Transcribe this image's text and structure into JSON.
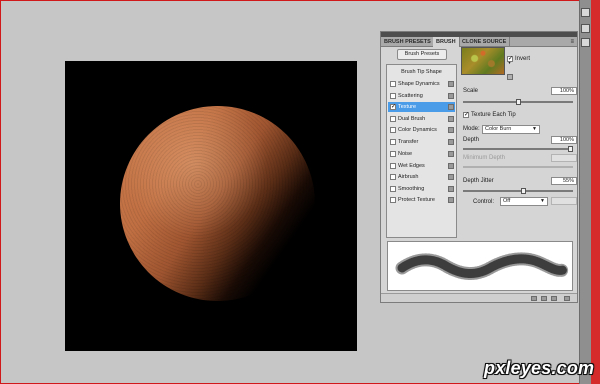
{
  "tabs": [
    "BRUSH PRESETS",
    "BRUSH",
    "CLONE SOURCE"
  ],
  "panel_menu_icon": "panel-menu-icon",
  "brush_presets_button": "Brush Presets",
  "brush_tip_shape": "Brush Tip Shape",
  "options": [
    {
      "label": "Shape Dynamics",
      "checked": false
    },
    {
      "label": "Scattering",
      "checked": false
    },
    {
      "label": "Texture",
      "checked": true,
      "selected": true
    },
    {
      "label": "Dual Brush",
      "checked": false
    },
    {
      "label": "Color Dynamics",
      "checked": false
    },
    {
      "label": "Transfer",
      "checked": false
    },
    {
      "label": "Noise",
      "checked": false
    },
    {
      "label": "Wet Edges",
      "checked": false
    },
    {
      "label": "Airbrush",
      "checked": false
    },
    {
      "label": "Smoothing",
      "checked": false
    },
    {
      "label": "Protect Texture",
      "checked": false
    }
  ],
  "texture": {
    "invert_label": "Invert",
    "invert_checked": true,
    "scale_label": "Scale",
    "scale_value": "100%",
    "scale_level": 0.5,
    "each_tip_label": "Texture Each Tip",
    "each_tip_checked": true,
    "mode_label": "Mode:",
    "mode_value": "Color Burn",
    "depth_label": "Depth",
    "depth_value": "100%",
    "depth_level": 1.0,
    "min_depth_label": "Minimum Depth",
    "depth_jitter_label": "Depth Jitter",
    "depth_jitter_value": "55%",
    "depth_jitter_level": 0.55,
    "control_label": "Control:",
    "control_value": "Off"
  },
  "watermark": "pxleyes.com"
}
